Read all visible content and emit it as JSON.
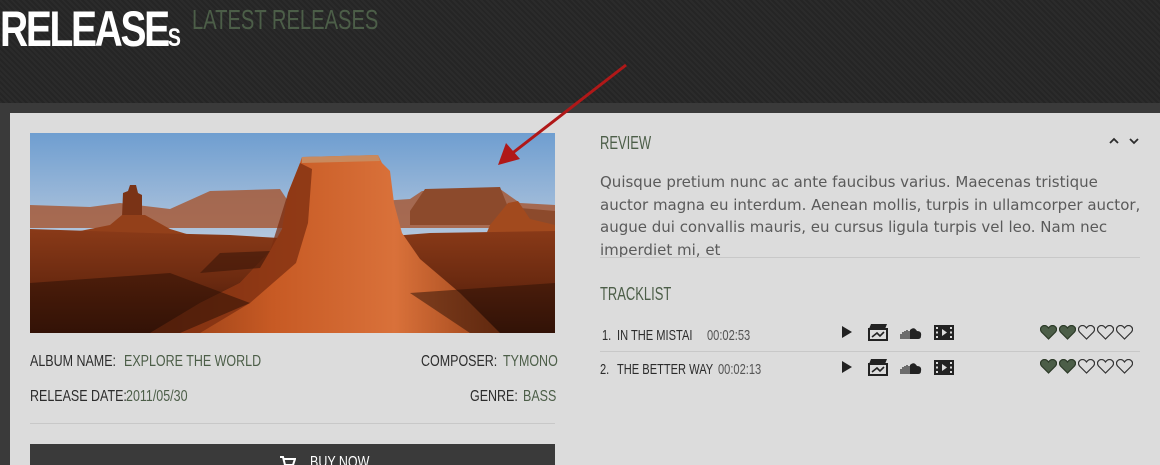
{
  "header": {
    "title_main": "RELEASE",
    "title_small": "s",
    "subtitle": "LATEST RELEASES"
  },
  "album": {
    "name_label": "ALBUM NAME:",
    "name_value": "EXPLORE THE WORLD",
    "composer_label": "COMPOSER:",
    "composer_value": "TYMONO",
    "date_label": "RELEASE DATE:",
    "date_value": "2011/05/30",
    "genre_label": "GENRE:",
    "genre_value": "BASS",
    "buy_label": "BUY NOW"
  },
  "review": {
    "title": "REVIEW",
    "text": "Quisque pretium nunc ac ante faucibus varius. Maecenas tristique auctor magna eu interdum. Aenean mollis, turpis in ullamcorper auctor, augue dui convallis mauris, eu cursus ligula turpis vel leo. Nam nec imperdiet mi, et"
  },
  "tracklist": {
    "title": "TRACKLIST",
    "tracks": [
      {
        "num": "1.",
        "title": "IN THE MISTAI",
        "time": "00:02:53",
        "rating": 2,
        "max_rating": 5
      },
      {
        "num": "2.",
        "title": "THE BETTER WAY",
        "time": "00:02:13",
        "rating": 2,
        "max_rating": 5
      }
    ]
  },
  "icons": {
    "track_actions": [
      "play-icon",
      "film-clapper-icon",
      "soundcloud-icon",
      "video-icon"
    ],
    "buy": "cart-icon",
    "collapse": [
      "chevron-up-icon",
      "chevron-down-icon"
    ],
    "rating": "heart-icon"
  },
  "colors": {
    "accent": "#4c5e48",
    "annotation_arrow": "#b01818",
    "background_dark": "#262626",
    "panel": "#dcdcdc"
  }
}
